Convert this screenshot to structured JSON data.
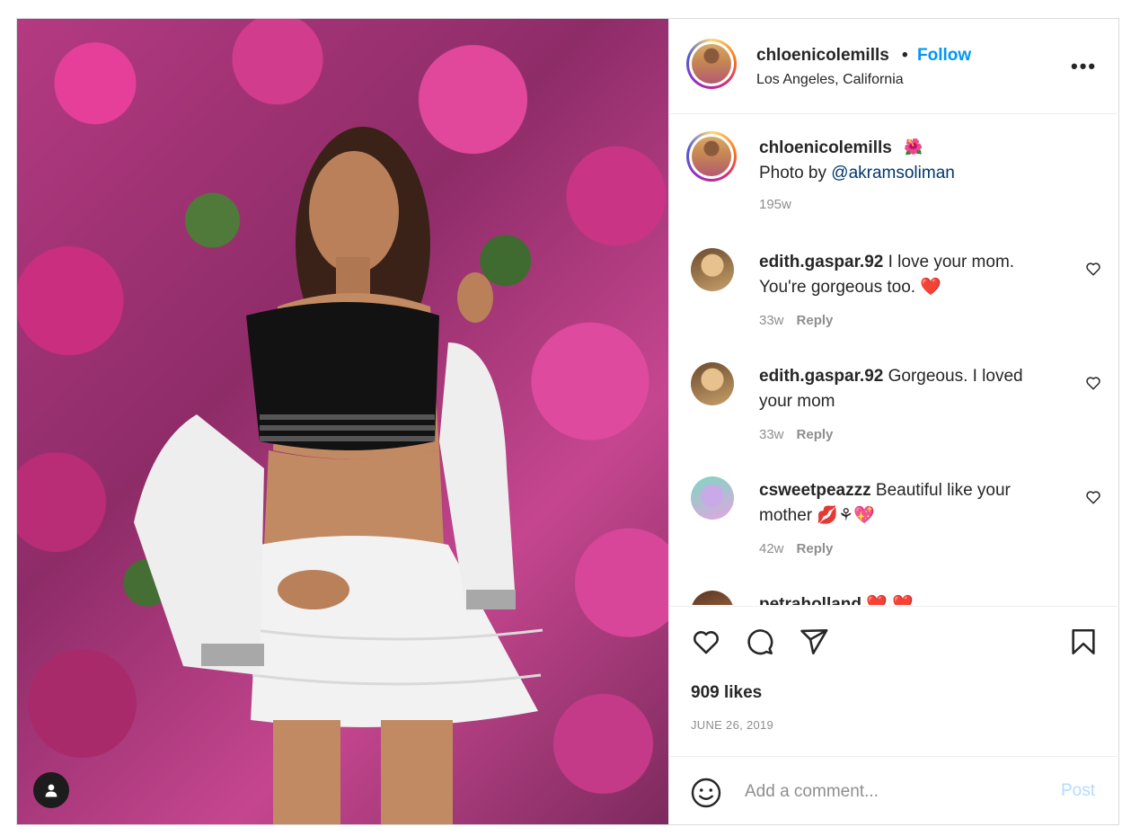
{
  "post": {
    "header": {
      "username": "chloenicolemills",
      "separator": "•",
      "follow_label": "Follow",
      "location": "Los Angeles, California",
      "more_icon": "more-horizontal-icon"
    },
    "caption": {
      "username": "chloenicolemills",
      "emoji": "🌺",
      "text_prefix": "Photo by ",
      "mention": "@akramsoliman",
      "time": "195w"
    },
    "comments": [
      {
        "username": "edith.gaspar.92",
        "text": " I love your mom. You're gorgeous too. ❤️",
        "time": "33w",
        "reply_label": "Reply"
      },
      {
        "username": "edith.gaspar.92",
        "text": " Gorgeous. I loved your mom",
        "time": "33w",
        "reply_label": "Reply"
      },
      {
        "username": "csweetpeazzz",
        "text": " Beautiful like your mother 💋⚘💖",
        "time": "42w",
        "reply_label": "Reply"
      },
      {
        "username": "petraholland",
        "text": " ❤️ ❤️",
        "time": "",
        "reply_label": ""
      }
    ],
    "actions": {
      "icons": [
        "heart-icon",
        "comment-icon",
        "share-icon",
        "bookmark-icon"
      ],
      "likes": "909 likes",
      "date": "JUNE 26, 2019"
    },
    "add_comment": {
      "placeholder": "Add a comment...",
      "post_label": "Post"
    },
    "colors": {
      "accent": "#0095f6",
      "post_disabled": "#b3dbff",
      "muted": "#8e8e8e",
      "text": "#262626",
      "mention": "#00376b"
    }
  }
}
